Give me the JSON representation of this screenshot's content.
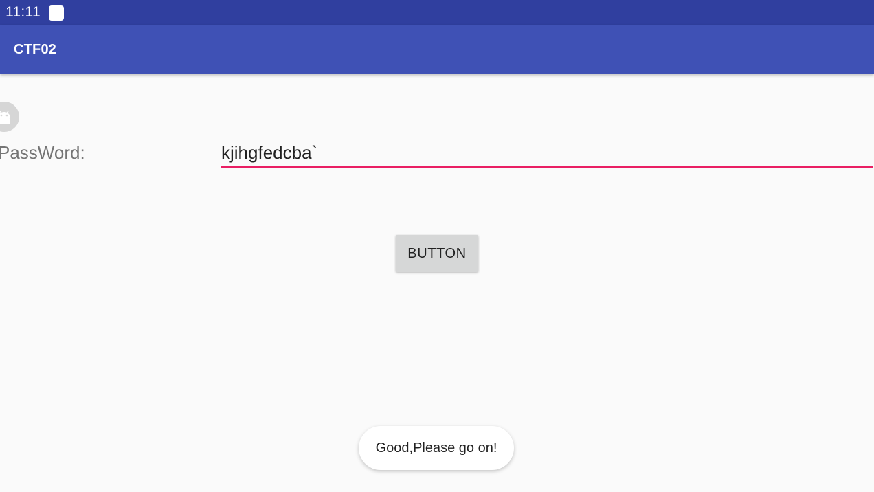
{
  "status_bar": {
    "time": "11:11",
    "notification_icon": "notification-square-icon"
  },
  "app_bar": {
    "title": "CTF02"
  },
  "form": {
    "avatar_icon": "android-default-avatar-icon",
    "password_label": "PassWord:",
    "password_value": "kjihgfedcba`",
    "button_label": "BUTTON"
  },
  "toast": {
    "message": "Good,Please go on!"
  },
  "colors": {
    "status_bar": "#303f9f",
    "app_bar": "#3f51b5",
    "accent": "#e91e63",
    "background": "#fafafa",
    "button": "#d6d7d7"
  }
}
